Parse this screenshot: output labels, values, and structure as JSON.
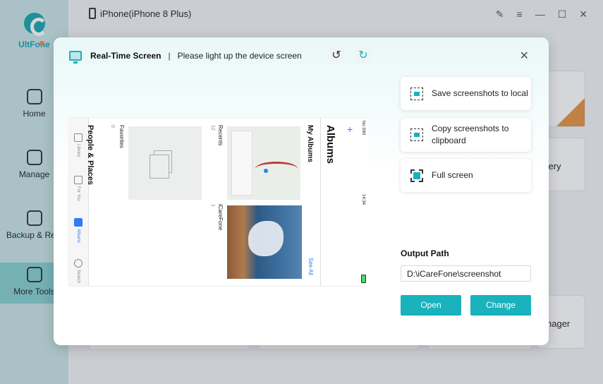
{
  "app": {
    "brand": "UltFone",
    "device_title": "iPhone(iPhone 8 Plus)",
    "nav": [
      {
        "label": "Home"
      },
      {
        "label": "Manage"
      },
      {
        "label": "Backup & Rest"
      },
      {
        "label": "More Tools",
        "active": true
      }
    ],
    "background_cards": [
      "very",
      "nager"
    ]
  },
  "modal": {
    "title": "Real-Time Screen",
    "separator": "|",
    "subtitle": "Please light up the device screen",
    "rotate_icon": "rotate-left-icon",
    "refresh_icon": "refresh-icon",
    "close_icon": "close-icon",
    "preview": {
      "status_carrier": "No SIM",
      "status_time": "14:34",
      "albums_heading": "Albums",
      "my_albums": "My Albums",
      "see_all": "See All",
      "plus": "+",
      "recents_label": "Recents",
      "recents_count": "12",
      "favorites_label": "Favorites",
      "favorites_count": "0",
      "icarefone_label": "iCareFone",
      "icarefone_count": "1",
      "people_heading": "People & Places",
      "tabs": [
        {
          "label": "Library",
          "icon": "photo-library-icon"
        },
        {
          "label": "For You",
          "icon": "for-you-icon"
        },
        {
          "label": "Albums",
          "icon": "albums-icon",
          "active": true
        },
        {
          "label": "Search",
          "icon": "search-icon"
        }
      ]
    },
    "actions": [
      {
        "label": "Save screenshots to local",
        "icon": "save-screenshot-icon"
      },
      {
        "label": "Copy screenshots to clipboard",
        "icon": "copy-screenshot-icon"
      },
      {
        "label": "Full screen",
        "icon": "fullscreen-icon"
      }
    ],
    "output_path_label": "Output Path",
    "output_path_value": "D:\\iCareFone\\screenshot",
    "open_label": "Open",
    "change_label": "Change"
  },
  "colors": {
    "accent": "#19b2bd",
    "sidebar": "#c9e6e8",
    "ios_blue": "#2f7cf6"
  }
}
